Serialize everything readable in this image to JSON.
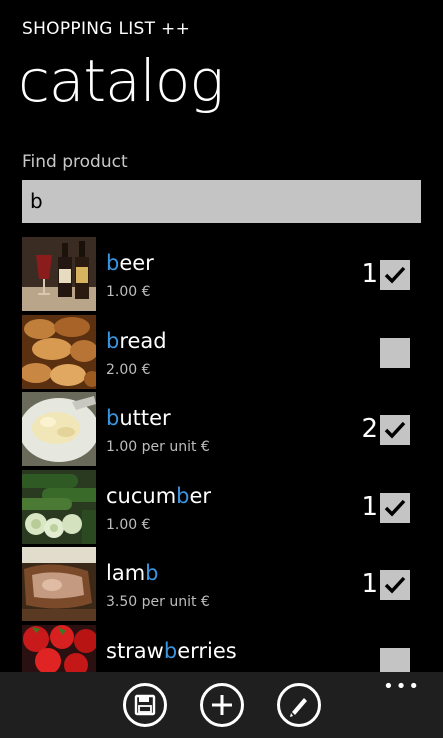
{
  "app_title": "SHOPPING LIST ++",
  "page_title": "catalog",
  "search": {
    "label": "Find product",
    "value": "b"
  },
  "products": [
    {
      "name_pre": "",
      "name_hl": "b",
      "name_post": "eer",
      "price": "1.00 €",
      "qty": "1",
      "checked": true,
      "image": "beer-bottles"
    },
    {
      "name_pre": "",
      "name_hl": "b",
      "name_post": "read",
      "price": "2.00 €",
      "qty": "",
      "checked": false,
      "image": "bread-rolls"
    },
    {
      "name_pre": "",
      "name_hl": "b",
      "name_post": "utter",
      "price": "1.00 per unit €",
      "qty": "2",
      "checked": true,
      "image": "butter-plate"
    },
    {
      "name_pre": "cucum",
      "name_hl": "b",
      "name_post": "er",
      "price": "1.00 €",
      "qty": "1",
      "checked": true,
      "image": "sliced-cucumbers"
    },
    {
      "name_pre": "lam",
      "name_hl": "b",
      "name_post": "",
      "price": "3.50 per unit €",
      "qty": "1",
      "checked": true,
      "image": "lamb-roast"
    },
    {
      "name_pre": "straw",
      "name_hl": "b",
      "name_post": "erries",
      "price": "",
      "qty": "",
      "checked": false,
      "image": "strawberries"
    }
  ],
  "appbar": {
    "buttons": [
      "save-icon",
      "add-icon",
      "edit-icon"
    ],
    "more": "•••"
  },
  "colors": {
    "accent": "#3c95e0",
    "background": "#000000",
    "control": "#c4c4c4"
  }
}
